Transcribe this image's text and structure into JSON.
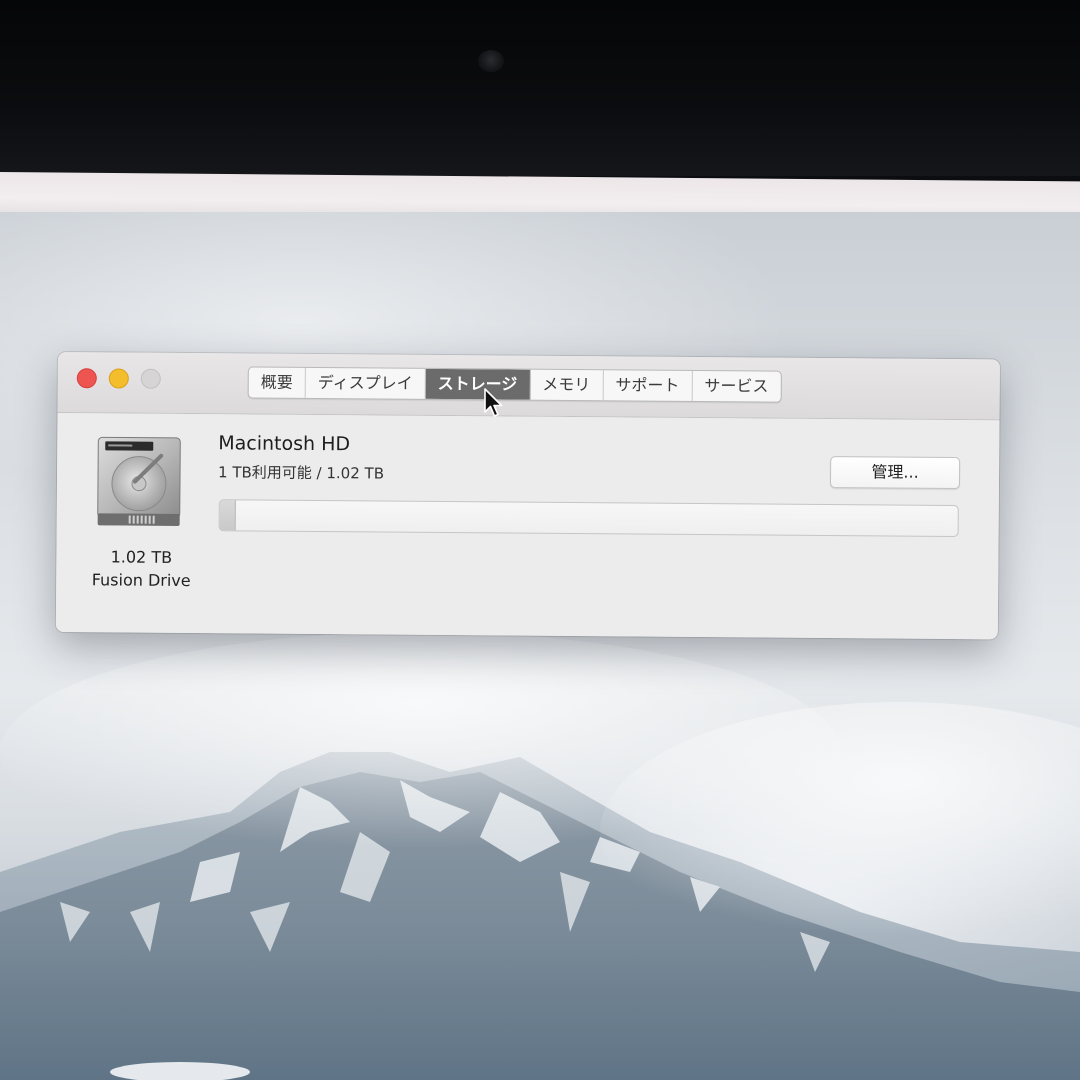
{
  "window": {
    "tabs": [
      {
        "label": "概要",
        "selected": false
      },
      {
        "label": "ディスプレイ",
        "selected": false
      },
      {
        "label": "ストレージ",
        "selected": true
      },
      {
        "label": "メモリ",
        "selected": false
      },
      {
        "label": "サポート",
        "selected": false
      },
      {
        "label": "サービス",
        "selected": false
      }
    ]
  },
  "storage": {
    "disk": {
      "size": "1.02 TB",
      "name": "Fusion Drive",
      "icon": "hard-drive-icon"
    },
    "volume": {
      "name": "Macintosh HD",
      "usage": "1 TB利用可能 / 1.02 TB",
      "used_fraction": 0.02
    },
    "manage_label": "管理..."
  },
  "colors": {
    "close": "#ee5450",
    "minimize": "#f3bd2c",
    "zoom": "#d6d4d5",
    "selected_tab": "#6b6b6b"
  }
}
